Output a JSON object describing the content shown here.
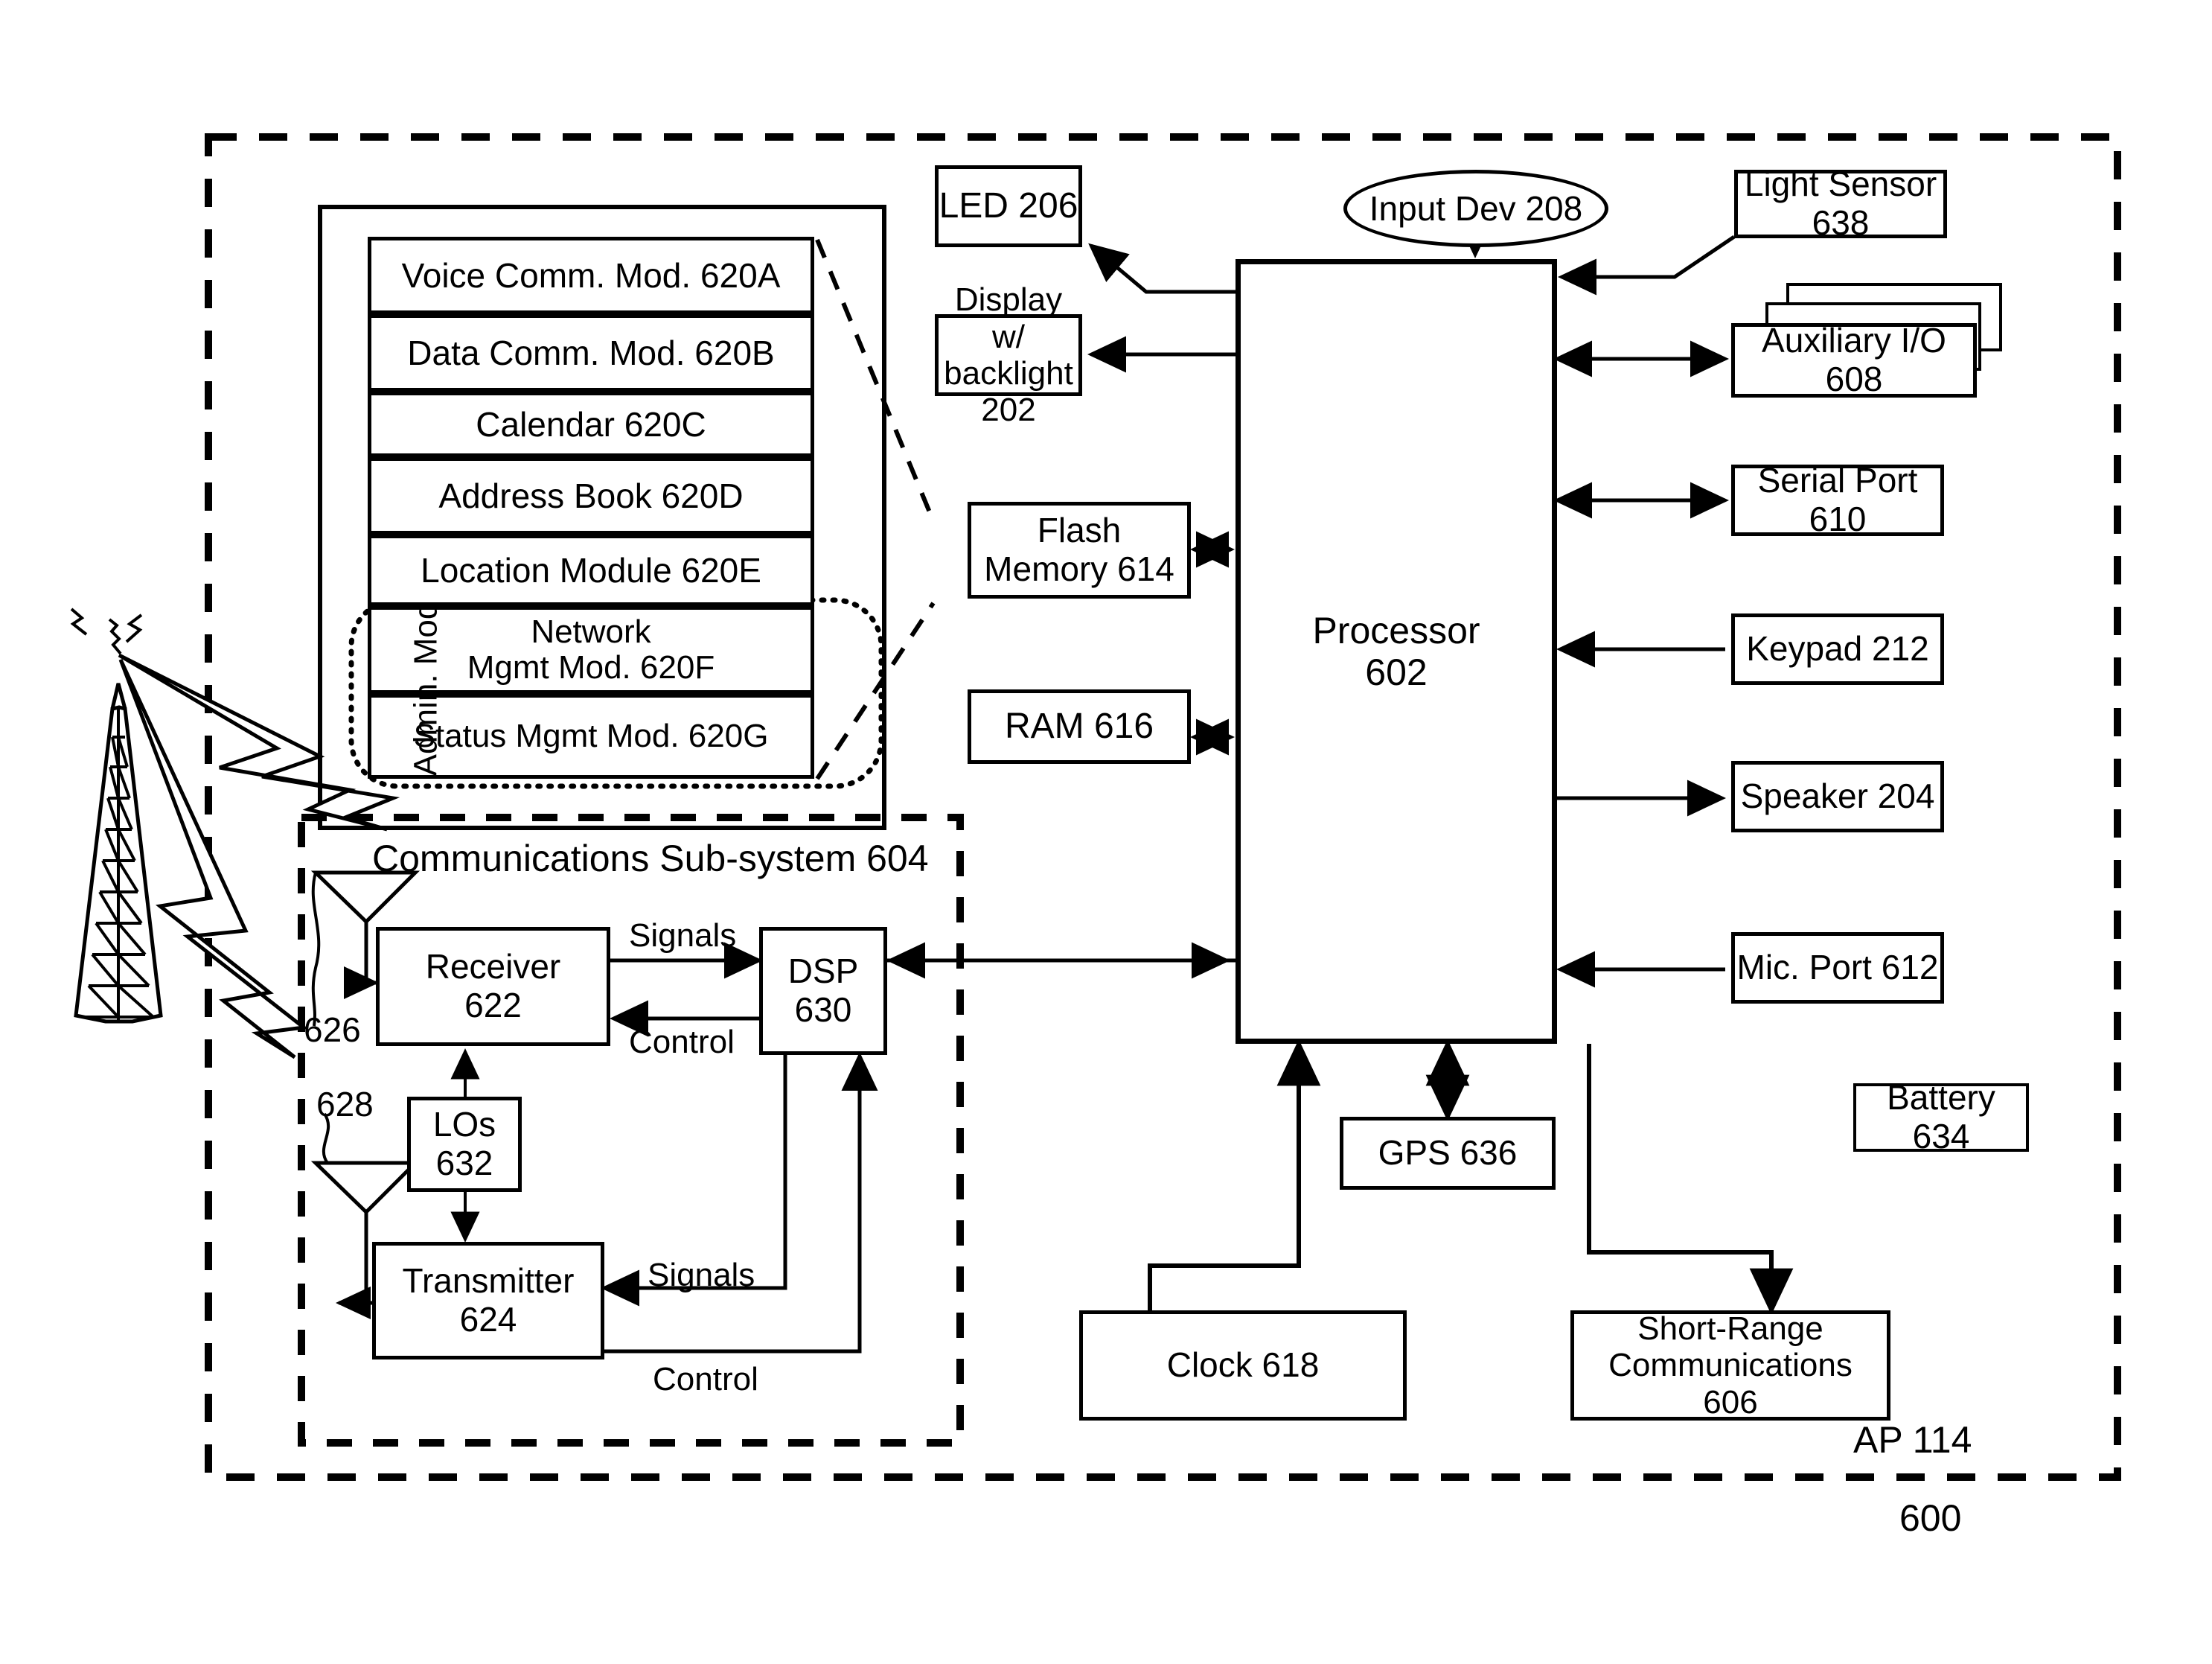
{
  "figure": {
    "number": "600",
    "system_label": "AP 114"
  },
  "boundaries": {
    "ap_boundary": "AP 114",
    "comm_subsystem": "Communications Sub-system 604",
    "admin_group": "Admin. Mod"
  },
  "memory_modules": [
    {
      "label": "Voice Comm. Mod. 620A"
    },
    {
      "label": "Data Comm. Mod. 620B"
    },
    {
      "label": "Calendar 620C"
    },
    {
      "label": "Address Book 620D"
    },
    {
      "label": "Location Module 620E"
    },
    {
      "label": "Network\nMgmt Mod. 620F",
      "line1": "Network",
      "line2": "Mgmt Mod. 620F"
    },
    {
      "label": "Status Mgmt Mod. 620G"
    }
  ],
  "core": {
    "processor_line1": "Processor",
    "processor_line2": "602"
  },
  "left_column": [
    {
      "label": "LED 206"
    },
    {
      "line1": "Display w/",
      "line2": "backlight 202"
    },
    {
      "line1": "Flash",
      "line2": "Memory 614"
    },
    {
      "label": "RAM 616"
    }
  ],
  "input_device": {
    "label": "Input Dev 208"
  },
  "right_column": [
    {
      "label": "Light Sensor 638"
    },
    {
      "label": "Auxiliary I/O 608"
    },
    {
      "label": "Serial Port 610"
    },
    {
      "label": "Keypad 212"
    },
    {
      "label": "Speaker 204"
    },
    {
      "label": "Mic. Port 612"
    }
  ],
  "bottom_row": [
    {
      "label": "GPS 636"
    },
    {
      "label": "Clock 618"
    },
    {
      "line1": "Short-Range",
      "line2": "Communications",
      "line3": "606"
    },
    {
      "label": "Battery 634"
    }
  ],
  "comm": {
    "receiver_line1": "Receiver",
    "receiver_line2": "622",
    "transmitter_line1": "Transmitter",
    "transmitter_line2": "624",
    "dsp_line1": "DSP",
    "dsp_line2": "630",
    "los_line1": "LOs",
    "los_line2": "632",
    "antenna_rx_ref": "626",
    "antenna_tx_ref": "628",
    "signals_top": "Signals",
    "control_top": "Control",
    "signals_bottom": "Signals",
    "control_bottom": "Control"
  }
}
